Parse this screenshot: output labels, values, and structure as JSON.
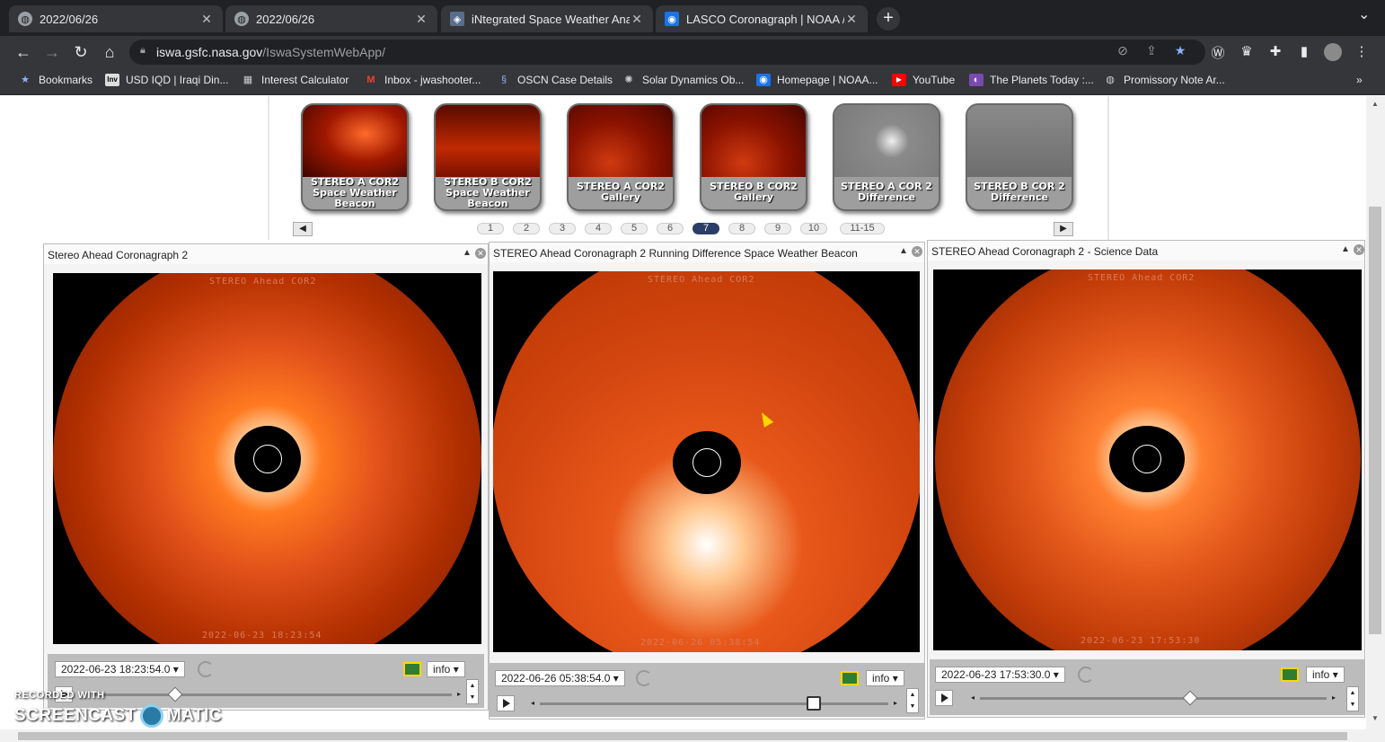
{
  "browser": {
    "tabs": [
      {
        "title": "2022/06/26",
        "active": false
      },
      {
        "title": "2022/06/26",
        "active": false
      },
      {
        "title": "iNtegrated Space Weather Analy",
        "active": false
      },
      {
        "title": "LASCO Coronagraph | NOAA / N",
        "active": true
      }
    ],
    "new_tab_label": "+",
    "url_host": "iswa.gsfc.nasa.gov",
    "url_path": "/IswaSystemWebApp/",
    "bookmarks": [
      "Bookmarks",
      "USD IQD | Iraqi Din...",
      "Interest Calculator",
      "Inbox - jwashooter...",
      "OSCN Case Details",
      "Solar Dynamics Ob...",
      "Homepage | NOAA...",
      "YouTube",
      "The Planets Today :...",
      "Promissory Note Ar..."
    ],
    "bookmark_overflow": "»"
  },
  "gallery": {
    "thumbnails": [
      {
        "label": "STEREO A COR2 Space Weather Beacon",
        "style": "red"
      },
      {
        "label": "STEREO B COR2 Space Weather Beacon",
        "style": "red"
      },
      {
        "label": "STEREO A COR2 Gallery",
        "style": "red"
      },
      {
        "label": "STEREO B COR2 Gallery",
        "style": "red"
      },
      {
        "label": "STEREO A COR 2 Difference",
        "style": "gray"
      },
      {
        "label": "STEREO B COR 2 Difference",
        "style": "gray"
      }
    ],
    "pages": [
      "1",
      "2",
      "3",
      "4",
      "5",
      "6",
      "7",
      "8",
      "9",
      "10",
      "11-15"
    ],
    "current_page": "7"
  },
  "panels": [
    {
      "title": "Stereo Ahead Coronagraph 2",
      "overlay_top": "STEREO Ahead COR2",
      "overlay_bottom": "2022-06-23 18:23:54",
      "date_value": "2022-06-23 18:23:54.0",
      "info_label": "info",
      "slider_position": 0.18
    },
    {
      "title": "STEREO Ahead Coronagraph 2 Running Difference Space Weather Beacon",
      "overlay_top": "STEREO Ahead COR2",
      "overlay_bottom": "2022-06-26 05:38:54",
      "date_value": "2022-06-26 05:38:54.0",
      "info_label": "info",
      "slider_position": 0.77
    },
    {
      "title": "STEREO Ahead Coronagraph 2 - Science Data",
      "overlay_top": "STEREO Ahead COR2",
      "overlay_bottom": "2022-06-23 17:53:30",
      "date_value": "2022-06-23 17:53:30.0",
      "info_label": "info",
      "slider_position": 0.6
    }
  ],
  "watermark": {
    "line1": "RECORDED WITH",
    "line2a": "SCREENCAST",
    "line2b": "MATIC"
  },
  "colors": {
    "chrome_bg": "#202124",
    "toolbar_bg": "#35363a",
    "corona_orange": "#e0501a",
    "pager_current": "#2b3f66"
  }
}
